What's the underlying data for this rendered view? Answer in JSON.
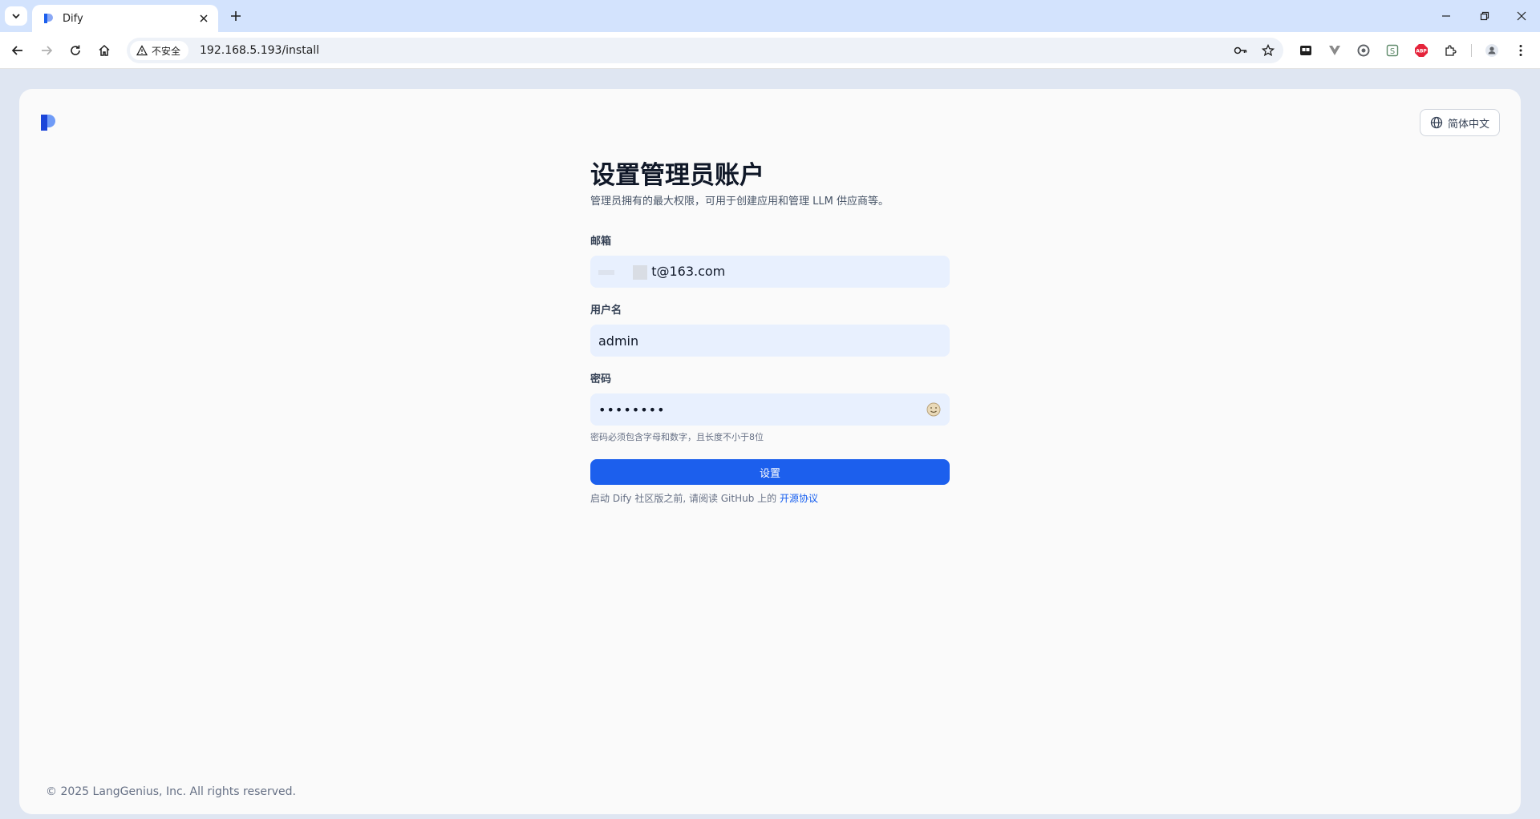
{
  "browser": {
    "tab_title": "Dify",
    "security_label": "不安全",
    "url": "192.168.5.193/install"
  },
  "page": {
    "language": "简体中文",
    "title": "设置管理员账户",
    "subtitle": "管理员拥有的最大权限，可用于创建应用和管理 LLM 供应商等。",
    "email": {
      "label": "邮箱",
      "value_visible_suffix": "t@163.com"
    },
    "username": {
      "label": "用户名",
      "value": "admin"
    },
    "password": {
      "label": "密码",
      "value": "••••••••",
      "hint": "密码必须包含字母和数字，且长度不小于8位"
    },
    "submit_label": "设置",
    "notice_prefix": "启动 Dify 社区版之前, 请阅读 GitHub 上的",
    "notice_link": "开源协议",
    "copyright": "© 2025 LangGenius, Inc. All rights reserved."
  },
  "colors": {
    "primary": "#1c5fed",
    "input_bg": "#e8f0fe",
    "chrome_tabstrip": "#d3e3fd"
  }
}
